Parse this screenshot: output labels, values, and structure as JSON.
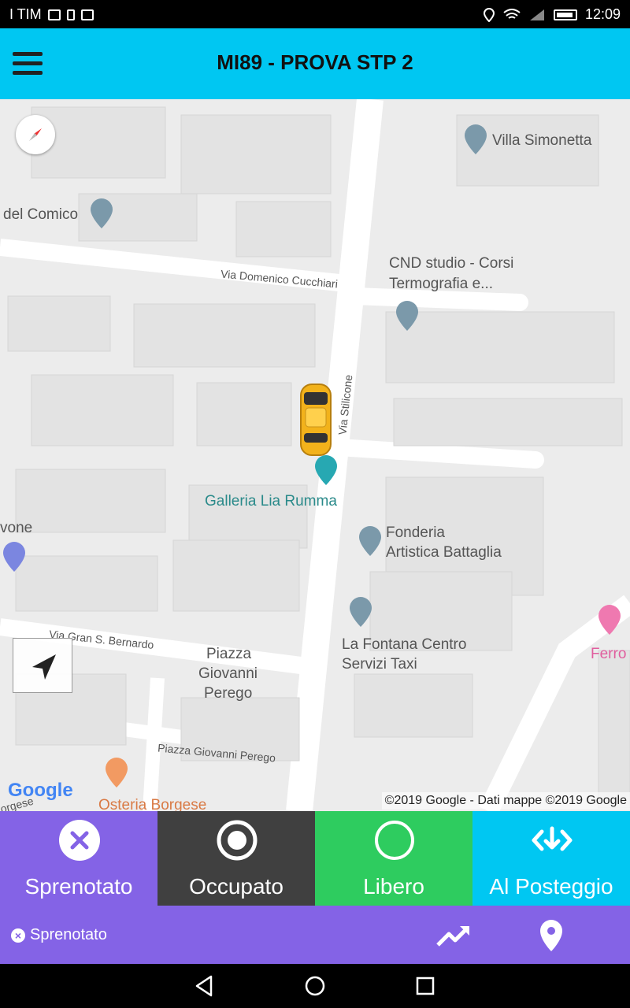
{
  "status_bar": {
    "carrier": "I TIM",
    "time": "12:09"
  },
  "app_bar": {
    "title": "MI89 - PROVA STP 2",
    "menu_icon": "hamburger-icon"
  },
  "map": {
    "labels": {
      "villa": "Villa Simonetta",
      "comico": "del Comico",
      "cnd1": "CND studio - Corsi",
      "cnd2": "Termografia e...",
      "galleria": "Galleria Lia Rumma",
      "vone": "vone",
      "fonderia1": "Fonderia",
      "fonderia2": "Artistica Battaglia",
      "fontana1": "La Fontana Centro",
      "fontana2": "Servizi Taxi",
      "ferro": "Ferro",
      "piazza1": "Piazza",
      "piazza2": "Giovanni",
      "piazza3": "Perego",
      "osteria": "Osteria Borgese",
      "borgese": "orgese"
    },
    "streets": {
      "cucchiari": "Via Domenico Cucchiari",
      "stilicone": "Via Stilicone",
      "bernardo": "Via Gran S. Bernardo",
      "perego": "Piazza Giovanni Perego"
    },
    "google_logo": "Google",
    "copyright": "©2019 Google - Dati mappe ©2019 Google"
  },
  "actions": [
    {
      "label": "Sprenotato",
      "color": "#8463e6",
      "icon": "x-circle-icon"
    },
    {
      "label": "Occupato",
      "color": "#404040",
      "icon": "record-icon"
    },
    {
      "label": "Libero",
      "color": "#2ecc5f",
      "icon": "circle-icon"
    },
    {
      "label": "Al Posteggio",
      "color": "#00c7f2",
      "icon": "arrows-down-icon"
    }
  ],
  "info_bar": {
    "status_label": "Sprenotato",
    "color": "#8463e6",
    "trend_icon": "trending-up-icon",
    "pin_icon": "map-pin-icon"
  },
  "colors": {
    "appbar": "#00c7f2",
    "map_bg": "#ececec"
  }
}
